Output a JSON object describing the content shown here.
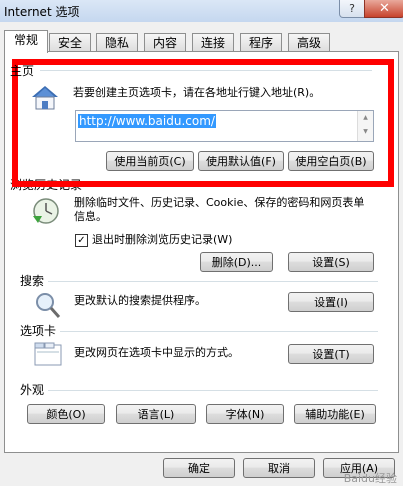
{
  "window": {
    "title": "Internet 选项",
    "help_label": "?",
    "close_label": "✕"
  },
  "tabs": [
    {
      "label": "常规",
      "active": true
    },
    {
      "label": "安全",
      "active": false
    },
    {
      "label": "隐私",
      "active": false
    },
    {
      "label": "内容",
      "active": false
    },
    {
      "label": "连接",
      "active": false
    },
    {
      "label": "程序",
      "active": false
    },
    {
      "label": "高级",
      "active": false
    }
  ],
  "homepage": {
    "title": "主页",
    "icon": "house-icon",
    "description": "若要创建主页选项卡，请在各地址行键入地址(R)。",
    "url": "http://www.baidu.com/",
    "buttons": [
      "使用当前页(C)",
      "使用默认值(F)",
      "使用空白页(B)"
    ]
  },
  "history": {
    "title": "浏览历史记录",
    "icon": "clock-icon",
    "description": "删除临时文件、历史记录、Cookie、保存的密码和网页表单信息。",
    "checkbox_label": "退出时删除浏览历史记录(W)",
    "checkbox_checked": true,
    "delete_label": "删除(D)...",
    "settings_label": "设置(S)"
  },
  "search": {
    "title": "搜索",
    "icon": "magnifier-icon",
    "description": "更改默认的搜索提供程序。",
    "settings_label": "设置(I)"
  },
  "tabs_section": {
    "title": "选项卡",
    "icon": "window-tabs-icon",
    "description": "更改网页在选项卡中显示的方式。",
    "settings_label": "设置(T)"
  },
  "appearance": {
    "title": "外观",
    "buttons": [
      "颜色(O)",
      "语言(L)",
      "字体(N)",
      "辅助功能(E)"
    ]
  },
  "footer": {
    "ok_label": "确定",
    "cancel_label": "取消",
    "apply_label": "应用(A)"
  },
  "watermark": "Baidu经验",
  "colors": {
    "annotation": "#ff0000",
    "selection": "#3399ff"
  }
}
